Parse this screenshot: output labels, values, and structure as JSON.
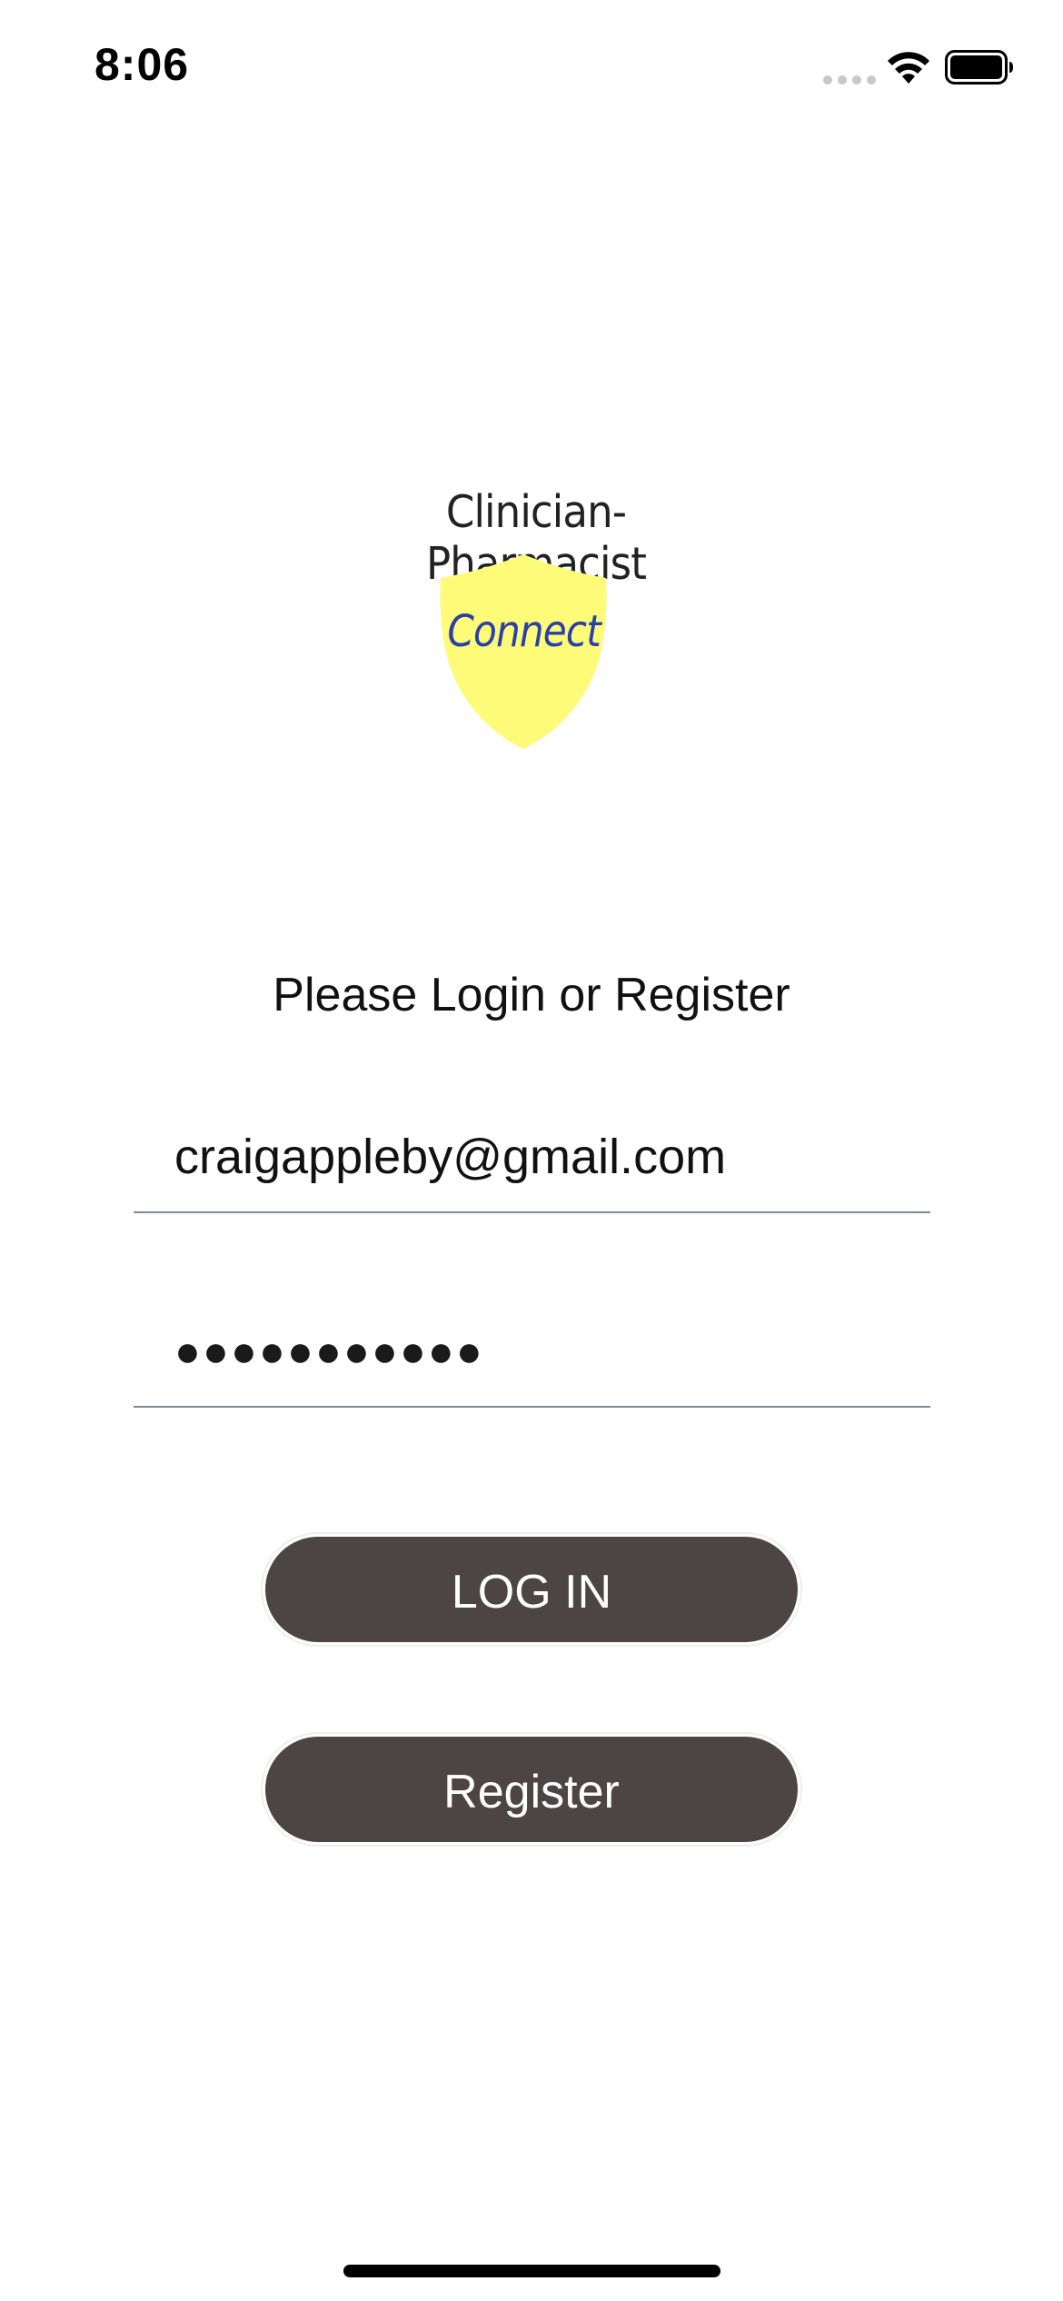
{
  "status_bar": {
    "time": "8:06"
  },
  "logo": {
    "title": "Clinician-Pharmacist",
    "shield_text": "Connect",
    "shield_color": "#fdfb78",
    "shield_text_color": "#2a3fa8"
  },
  "login": {
    "prompt": "Please Login or Register",
    "email_value": "craigappleby@gmail.com",
    "password_mask": "●●●●●●●●●●●",
    "login_label": "LOG IN",
    "register_label": "Register"
  },
  "colors": {
    "button_bg": "#4d4544",
    "button_text": "#ffffff",
    "field_underline": "#7f8a9e"
  }
}
